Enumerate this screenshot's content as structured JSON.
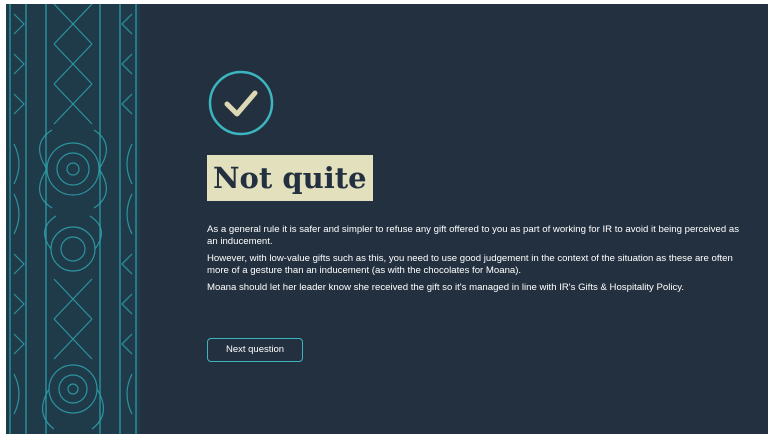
{
  "feedback": {
    "title": "Not quite",
    "paragraphs": [
      "As a general rule it is safer and simpler to refuse any gift offered to you as part of working for IR to avoid it being perceived as an inducement.",
      "However, with low-value gifts such as this, you need to use good judgement in the context of the situation as these are often more of a gesture than an inducement (as with the chocolates for Moana).",
      "Moana should let her leader know she received the gift so it's managed in line with IR's Gifts & Hospitality Policy."
    ],
    "next_button_label": "Next question",
    "icon": "checkmark-circle-icon"
  },
  "decor": {
    "pattern": "maori-kowhaiwhai-pattern"
  },
  "colors": {
    "background": "#23303f",
    "accent_teal": "#3bb6bf",
    "badge_bg": "#e3e0be",
    "check_color": "#dcd9b4",
    "text": "#ffffff"
  }
}
